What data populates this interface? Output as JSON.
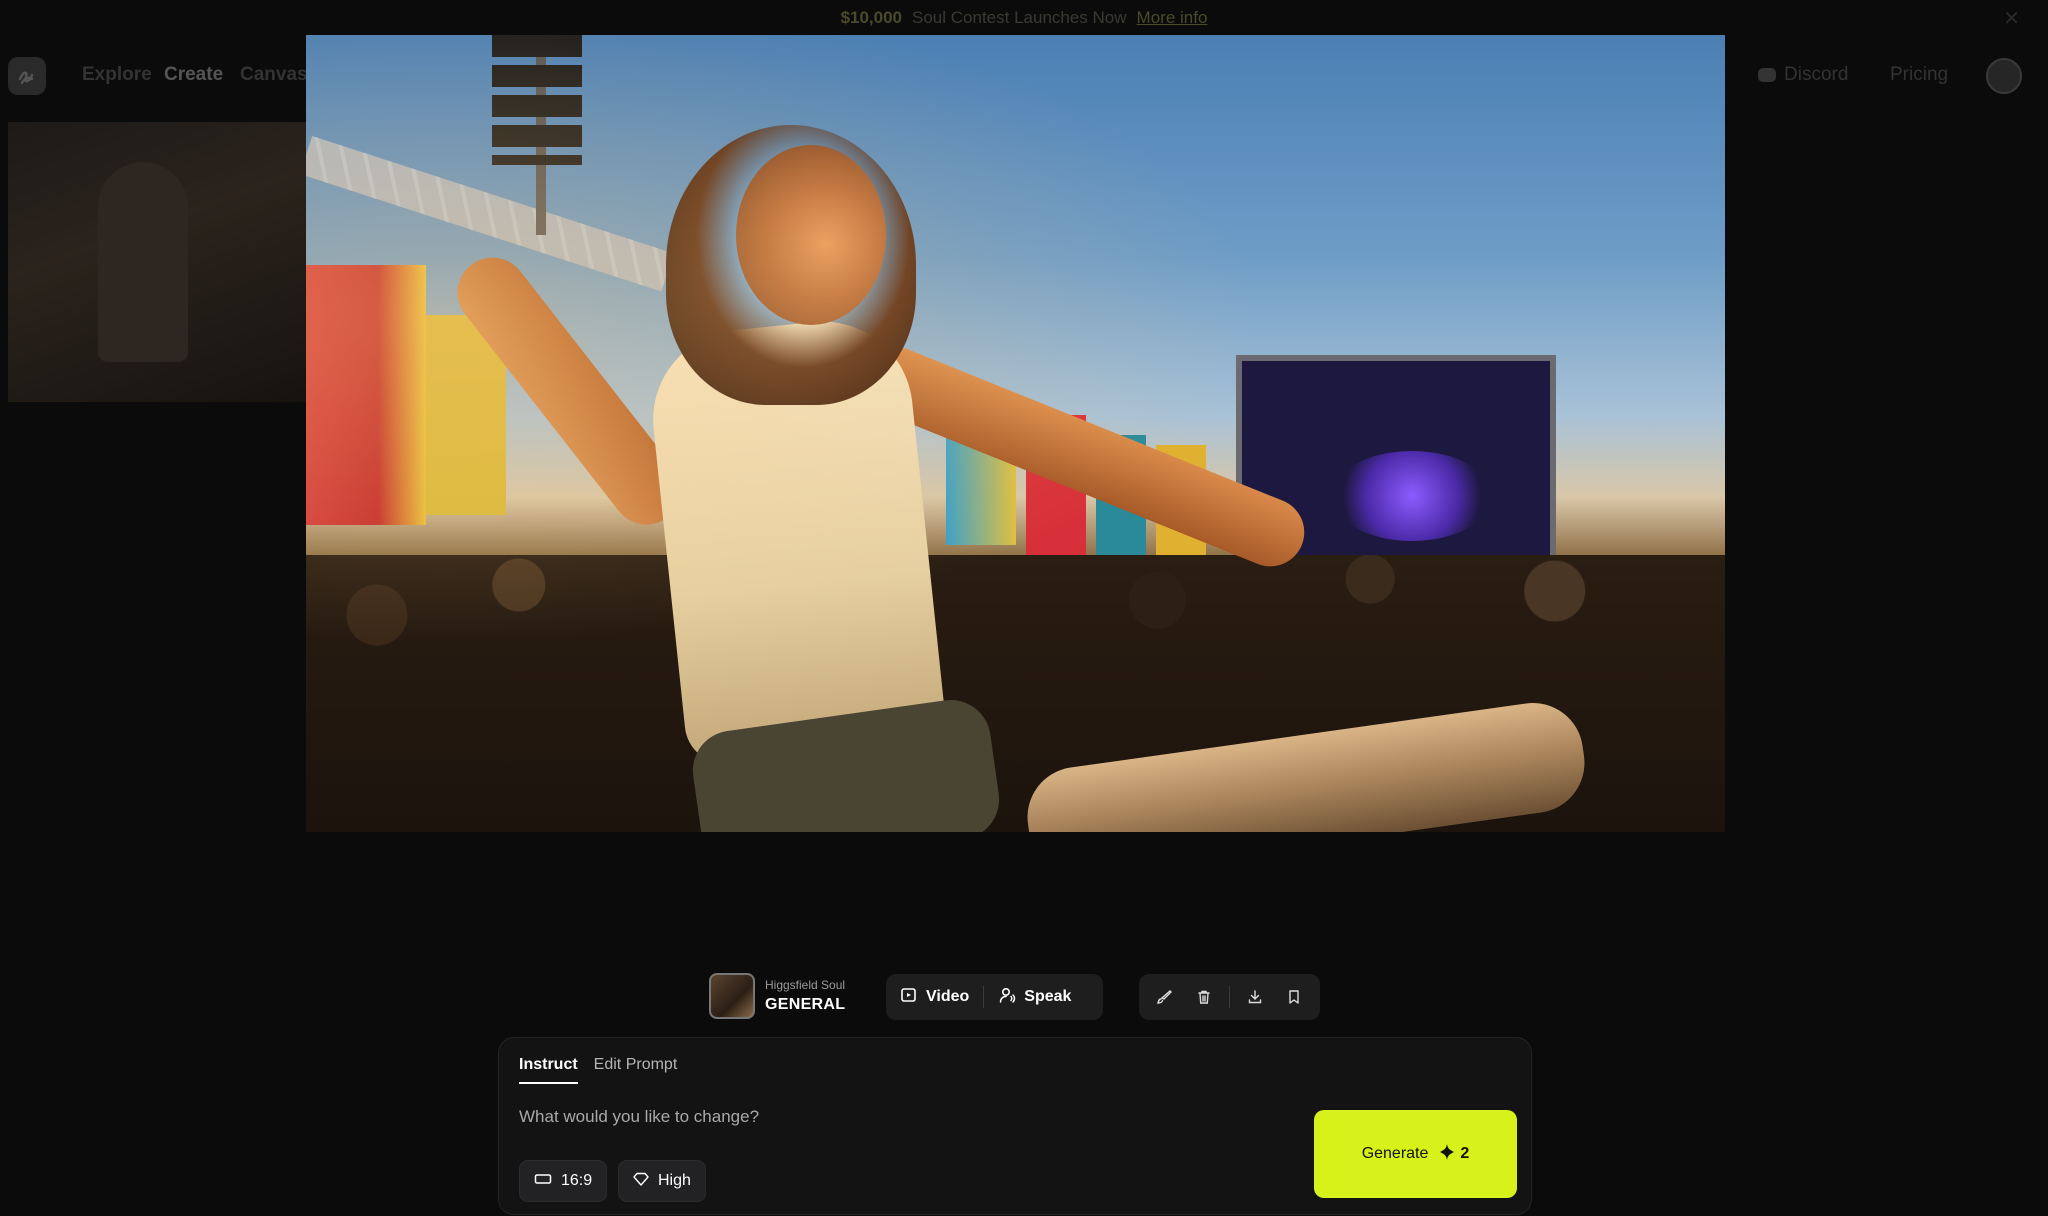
{
  "banner": {
    "amount": "$10,000",
    "text": "Soul Contest Launches Now",
    "link": "More info"
  },
  "nav": {
    "items": [
      "Explore",
      "Create",
      "Canvas"
    ],
    "right": [
      "Discord",
      "Pricing"
    ]
  },
  "model": {
    "subtitle": "Higgsfield Soul",
    "name": "GENERAL"
  },
  "actions": {
    "video_label": "Video",
    "speak_label": "Speak"
  },
  "tools": [
    "brush-icon",
    "trash-icon",
    "download-icon",
    "bookmark-icon"
  ],
  "panel": {
    "tabs": [
      {
        "label": "Instruct",
        "active": true
      },
      {
        "label": "Edit Prompt",
        "active": false
      }
    ],
    "placeholder": "What would you like to change?",
    "aspect_ratio": "16:9",
    "quality": "High",
    "generate_label": "Generate",
    "generate_cost": "2"
  },
  "colors": {
    "accent": "#d6f21a",
    "panel_bg": "#131314",
    "background": "#000000"
  }
}
